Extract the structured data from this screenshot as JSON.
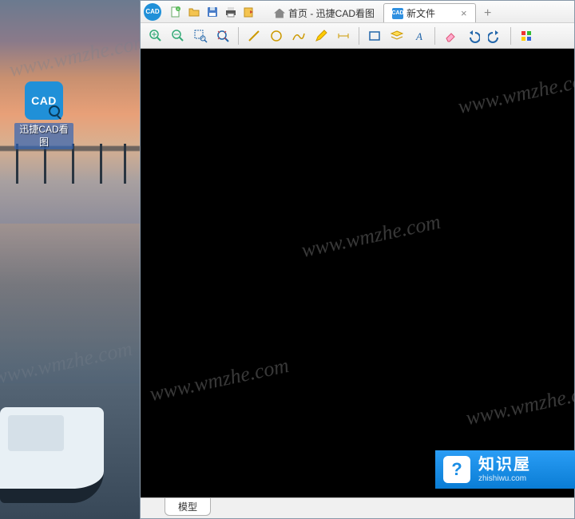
{
  "desktop": {
    "icon_label": "迅捷CAD看图",
    "icon_text": "CAD"
  },
  "app": {
    "logo_text": "CAD",
    "tabs": {
      "home": "首页 - 迅捷CAD看图",
      "newfile": "新文件",
      "newfile_icon": "CAD"
    },
    "bottom_tab": "模型"
  },
  "watermark": "www.wmzhe.com",
  "badge": {
    "title": "知识屋",
    "sub": "zhishiwu.com"
  },
  "icons": {
    "new": "new-file-icon",
    "open": "open-folder-icon",
    "save": "save-icon",
    "print": "print-icon",
    "export": "export-icon",
    "zoom_in": "zoom-in-icon",
    "zoom_out": "zoom-out-icon",
    "zoom_window": "zoom-window-icon",
    "zoom_extents": "zoom-extents-icon",
    "line": "line-icon",
    "circle": "circle-icon",
    "polyline": "polyline-icon",
    "pencil": "pencil-icon",
    "dim": "dimension-icon",
    "rect": "rect-icon",
    "layer": "layer-icon",
    "text": "text-icon",
    "erase": "erase-icon",
    "undo": "undo-icon",
    "redo": "redo-icon",
    "color": "color-icon"
  }
}
